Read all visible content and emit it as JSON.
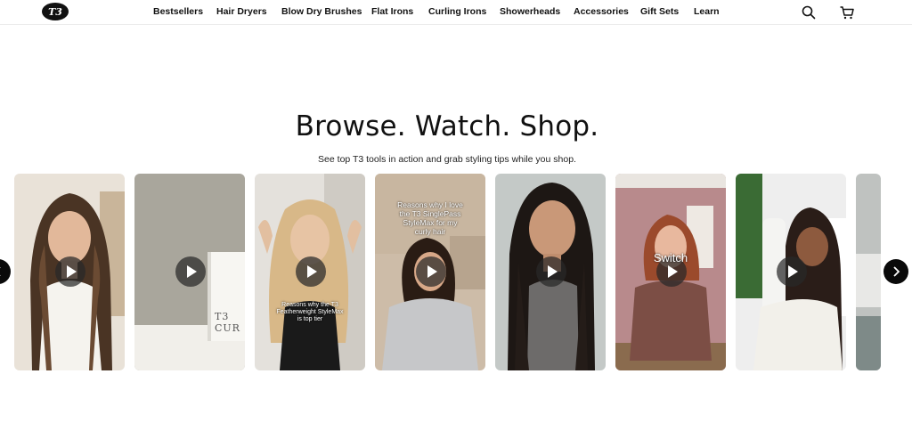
{
  "brand": {
    "logo_text": "T3"
  },
  "nav": {
    "items": [
      "Bestsellers",
      "Hair Dryers",
      "Blow Dry Brushes",
      "Flat Irons",
      "Curling Irons",
      "Showerheads",
      "Accessories",
      "Gift Sets",
      "Learn"
    ]
  },
  "header_icons": {
    "search": "search-icon",
    "cart": "cart-icon"
  },
  "hero": {
    "title": "Browse. Watch. Shop.",
    "subtitle": "See top T3 tools in action and grab styling tips while you shop."
  },
  "videos": [
    {
      "caption": ""
    },
    {
      "caption": "",
      "box_text": "T3 CUR"
    },
    {
      "caption": "Reasons why the T3 Featherweight StyleMax is top tier"
    },
    {
      "caption": "Reasons why I love the T3 SinglePass StyleMax for my curly hair"
    },
    {
      "caption": ""
    },
    {
      "caption": "Switch"
    },
    {
      "caption": ""
    },
    {
      "caption": ""
    }
  ],
  "colors": {
    "accent": "#0a0a0a",
    "text": "#111111"
  }
}
